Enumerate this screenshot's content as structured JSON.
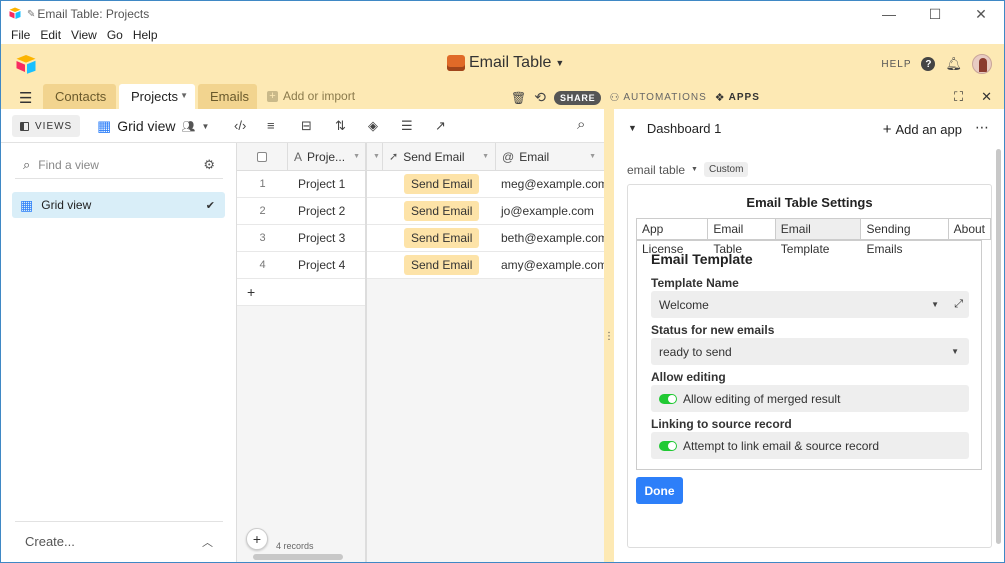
{
  "window": {
    "title": "Email Table: Projects",
    "controls": {
      "minimize": "—",
      "maximize": "☐",
      "close": "✕"
    }
  },
  "menu": [
    "File",
    "Edit",
    "View",
    "Go",
    "Help"
  ],
  "header": {
    "base_title": "Email Table",
    "help_label": "HELP"
  },
  "tabs": {
    "items": [
      {
        "label": "Contacts",
        "active": false
      },
      {
        "label": "Projects",
        "active": true
      },
      {
        "label": "Emails",
        "active": false
      }
    ],
    "add_import": "Add or import",
    "share": "SHARE",
    "automations": "AUTOMATIONS",
    "apps": "APPS"
  },
  "toolbar": {
    "views_label": "VIEWS",
    "grid_view": "Grid view"
  },
  "sidebar": {
    "find_placeholder": "Find a view",
    "view_item": "Grid view",
    "create_label": "Create..."
  },
  "grid": {
    "columns": [
      "Proje...",
      "Send Email",
      "Email"
    ],
    "rows": [
      {
        "num": "1",
        "name": "Project 1",
        "button": "Send Email",
        "email": "meg@example.com"
      },
      {
        "num": "2",
        "name": "Project 2",
        "button": "Send Email",
        "email": "jo@example.com"
      },
      {
        "num": "3",
        "name": "Project 3",
        "button": "Send Email",
        "email": "beth@example.com"
      },
      {
        "num": "4",
        "name": "Project 4",
        "button": "Send Email",
        "email": "amy@example.com"
      }
    ],
    "add_row": "+",
    "record_count": "4 records"
  },
  "dashboard": {
    "title": "Dashboard 1",
    "add_app": "Add an app",
    "app_name": "email table",
    "badge": "Custom",
    "settings_title": "Email Table Settings",
    "settings_tabs": [
      {
        "label": "App License",
        "selected": false
      },
      {
        "label": "Email Table",
        "selected": false
      },
      {
        "label": "Email Template",
        "selected": true
      },
      {
        "label": "Sending Emails",
        "selected": false
      },
      {
        "label": "About",
        "selected": false
      }
    ],
    "panel_heading": "Email Template",
    "template_name_label": "Template Name",
    "template_name_value": "Welcome",
    "status_label": "Status for new emails",
    "status_value": "ready to send",
    "allow_editing_label": "Allow editing",
    "allow_editing_toggle": "Allow editing of merged result",
    "allow_editing_on": true,
    "linking_label": "Linking to source record",
    "linking_toggle": "Attempt to link email & source record",
    "linking_on": true,
    "done_label": "Done"
  },
  "colors": {
    "header_bg": "#fde9b4",
    "accent_blue": "#2d7ff9",
    "toggle_green": "#20c933",
    "send_button_bg": "#fde3a8"
  }
}
